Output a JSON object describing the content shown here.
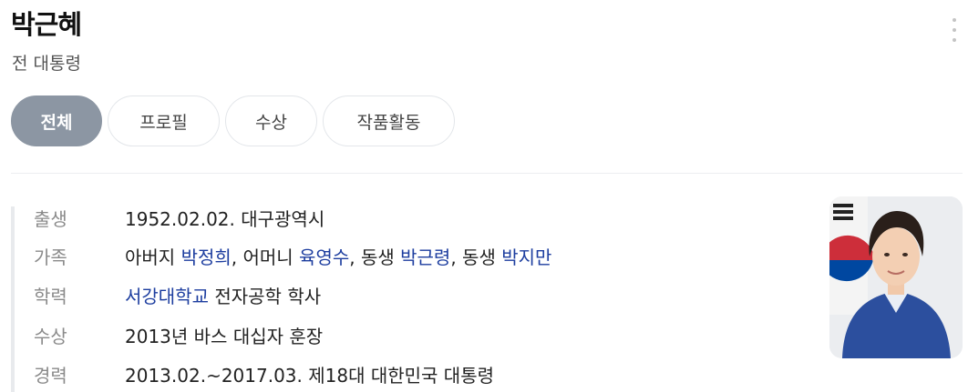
{
  "header": {
    "name": "박근혜",
    "subtitle": "전 대통령"
  },
  "tabs": [
    {
      "label": "전체",
      "active": true
    },
    {
      "label": "프로필",
      "active": false
    },
    {
      "label": "수상",
      "active": false
    },
    {
      "label": "작품활동",
      "active": false
    }
  ],
  "info": {
    "birth": {
      "label": "출생",
      "value": "1952.02.02. 대구광역시"
    },
    "family": {
      "label": "가족",
      "father_prefix": "아버지 ",
      "father": "박정희",
      "mother_prefix": ", 어머니 ",
      "mother": "육영수",
      "sibling1_prefix": ", 동생 ",
      "sibling1": "박근령",
      "sibling2_prefix": ", 동생 ",
      "sibling2": "박지만"
    },
    "education": {
      "label": "학력",
      "school": "서강대학교",
      "detail": " 전자공학 학사"
    },
    "award": {
      "label": "수상",
      "value": "2013년 바스 대십자 훈장"
    },
    "career": {
      "label": "경력",
      "value": "2013.02.~2017.03. 제18대 대한민국 대통령"
    }
  },
  "colors": {
    "active_tab": "#8c96a3",
    "link": "#1c3d9f",
    "photo_background": "#e9ecef",
    "flag_red": "#cd2e3a",
    "flag_blue": "#0047a0",
    "jacket_blue": "#2c4f9e"
  },
  "icons": {
    "more": "more-vertical-icon"
  }
}
